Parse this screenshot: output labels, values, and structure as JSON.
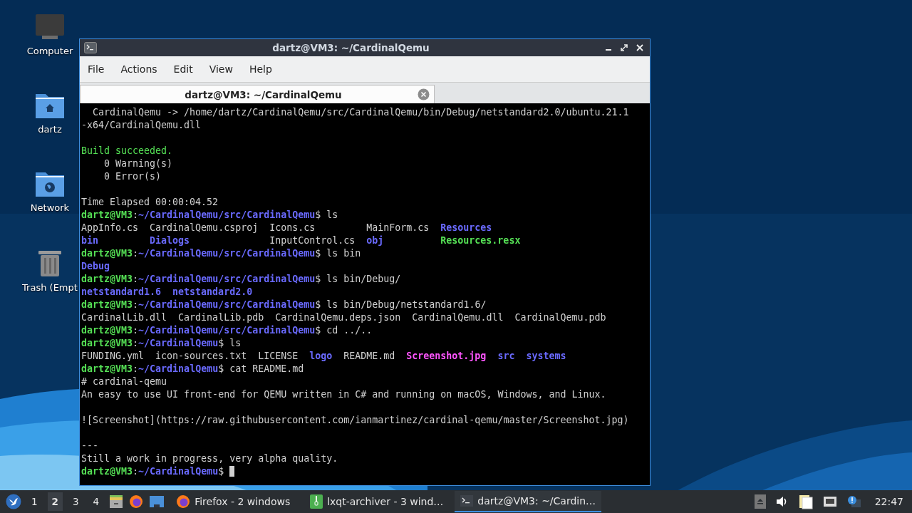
{
  "desktop_icons": [
    {
      "label": "Computer",
      "kind": "computer"
    },
    {
      "label": "dartz",
      "kind": "home"
    },
    {
      "label": "Network",
      "kind": "network"
    },
    {
      "label": "Trash (Empt",
      "kind": "trash"
    }
  ],
  "window": {
    "title": "dartz@VM3: ~/CardinalQemu",
    "menu": [
      "File",
      "Actions",
      "Edit",
      "View",
      "Help"
    ],
    "tabs": [
      {
        "label": "dartz@VM3: ~/CardinalQemu",
        "selected": true
      }
    ],
    "terminal_blocks": [
      {
        "lines": [
          {
            "kind": "text",
            "segments": [
              {
                "kind": "plain",
                "text": "  CardinalQemu -> /home/dartz/CardinalQemu/src/CardinalQemu/bin/Debug/netstandard2.0/ubuntu.21.1"
              }
            ]
          },
          {
            "kind": "text",
            "segments": [
              {
                "kind": "plain",
                "text": "-x64/CardinalQemu.dll"
              }
            ]
          }
        ]
      },
      {
        "lines": [
          {
            "kind": "text",
            "segments": [
              {
                "kind": "success",
                "text": "Build succeeded."
              }
            ]
          },
          {
            "kind": "text",
            "segments": [
              {
                "kind": "plain",
                "text": "    0 Warning(s)"
              }
            ]
          },
          {
            "kind": "text",
            "segments": [
              {
                "kind": "plain",
                "text": "    0 Error(s)"
              }
            ]
          }
        ]
      },
      {
        "lines": [
          {
            "kind": "text",
            "segments": [
              {
                "kind": "plain",
                "text": "Time Elapsed 00:00:04.52"
              }
            ]
          },
          {
            "kind": "text",
            "segments": [
              {
                "kind": "user",
                "text": "dartz@VM3"
              },
              {
                "kind": "plain",
                "text": ":"
              },
              {
                "kind": "path",
                "text": "~/CardinalQemu/src/CardinalQemu"
              },
              {
                "kind": "plain",
                "text": "$ ls"
              }
            ]
          },
          {
            "kind": "grid",
            "segments": [
              {
                "kind": "plain",
                "text": "AppInfo.cs"
              },
              {
                "kind": "plain",
                "text": "CardinalQemu.csproj"
              },
              {
                "kind": "plain",
                "text": "Icons.cs"
              },
              {
                "kind": "plain",
                "text": "MainForm.cs"
              },
              {
                "kind": "dir",
                "text": "Resources"
              }
            ]
          },
          {
            "kind": "grid",
            "segments": [
              {
                "kind": "dir",
                "text": "bin"
              },
              {
                "kind": "dir",
                "text": "Dialogs"
              },
              {
                "kind": "plain",
                "text": "InputControl.cs"
              },
              {
                "kind": "dir",
                "text": "obj"
              },
              {
                "kind": "exec",
                "text": "Resources.resx"
              }
            ]
          },
          {
            "kind": "text",
            "segments": [
              {
                "kind": "user",
                "text": "dartz@VM3"
              },
              {
                "kind": "plain",
                "text": ":"
              },
              {
                "kind": "path",
                "text": "~/CardinalQemu/src/CardinalQemu"
              },
              {
                "kind": "plain",
                "text": "$ ls bin"
              }
            ]
          },
          {
            "kind": "text",
            "segments": [
              {
                "kind": "dir",
                "text": "Debug"
              }
            ]
          },
          {
            "kind": "text",
            "segments": [
              {
                "kind": "user",
                "text": "dartz@VM3"
              },
              {
                "kind": "plain",
                "text": ":"
              },
              {
                "kind": "path",
                "text": "~/CardinalQemu/src/CardinalQemu"
              },
              {
                "kind": "plain",
                "text": "$ ls bin/Debug/"
              }
            ]
          },
          {
            "kind": "list",
            "segments": [
              {
                "kind": "dir",
                "text": "netstandard1.6"
              },
              {
                "kind": "dir",
                "text": "netstandard2.0"
              }
            ]
          },
          {
            "kind": "text",
            "segments": [
              {
                "kind": "user",
                "text": "dartz@VM3"
              },
              {
                "kind": "plain",
                "text": ":"
              },
              {
                "kind": "path",
                "text": "~/CardinalQemu/src/CardinalQemu"
              },
              {
                "kind": "plain",
                "text": "$ ls bin/Debug/netstandard1.6/"
              }
            ]
          },
          {
            "kind": "text",
            "segments": [
              {
                "kind": "plain",
                "text": "CardinalLib.dll  CardinalLib.pdb  CardinalQemu.deps.json  CardinalQemu.dll  CardinalQemu.pdb"
              }
            ]
          },
          {
            "kind": "text",
            "segments": [
              {
                "kind": "user",
                "text": "dartz@VM3"
              },
              {
                "kind": "plain",
                "text": ":"
              },
              {
                "kind": "path",
                "text": "~/CardinalQemu/src/CardinalQemu"
              },
              {
                "kind": "plain",
                "text": "$ cd ../.."
              }
            ]
          },
          {
            "kind": "text",
            "segments": [
              {
                "kind": "user",
                "text": "dartz@VM3"
              },
              {
                "kind": "plain",
                "text": ":"
              },
              {
                "kind": "path",
                "text": "~/CardinalQemu"
              },
              {
                "kind": "plain",
                "text": "$ ls"
              }
            ]
          },
          {
            "kind": "list",
            "segments": [
              {
                "kind": "plain",
                "text": "FUNDING.yml"
              },
              {
                "kind": "plain",
                "text": "icon-sources.txt"
              },
              {
                "kind": "plain",
                "text": "LICENSE"
              },
              {
                "kind": "dir",
                "text": "logo"
              },
              {
                "kind": "plain",
                "text": "README.md"
              },
              {
                "text": "Screenshot.jpg"
              },
              {
                "kind": "dir",
                "text": "src"
              },
              {
                "kind": "dir",
                "text": "systems"
              }
            ]
          },
          {
            "kind": "text",
            "segments": [
              {
                "kind": "user",
                "text": "dartz@VM3"
              },
              {
                "kind": "plain",
                "text": ":"
              },
              {
                "kind": "path",
                "text": "~/CardinalQemu"
              },
              {
                "kind": "plain",
                "text": "$ cat README.md"
              }
            ]
          },
          {
            "kind": "text",
            "segments": [
              {
                "kind": "plain",
                "text": "# cardinal-qemu"
              }
            ]
          },
          {
            "kind": "text",
            "segments": [
              {
                "kind": "plain",
                "text": "An easy to use UI front-end for QEMU written in C# and running on macOS, Windows, and Linux."
              }
            ]
          }
        ]
      },
      {
        "lines": [
          {
            "kind": "text",
            "segments": [
              {
                "kind": "plain",
                "text": "![Screenshot](https://raw.githubusercontent.com/ianmartinez/cardinal-qemu/master/Screenshot.jpg)"
              }
            ]
          }
        ]
      },
      {
        "lines": [
          {
            "kind": "text",
            "segments": [
              {
                "kind": "plain",
                "text": "---"
              }
            ]
          },
          {
            "kind": "text",
            "segments": [
              {
                "kind": "plain",
                "text": "Still a work in progress, very alpha quality."
              }
            ]
          },
          {
            "kind": "text",
            "segments": [
              {
                "kind": "user",
                "text": "dartz@VM3"
              },
              {
                "kind": "plain",
                "text": ":"
              },
              {
                "kind": "path",
                "text": "~/CardinalQemu"
              },
              {
                "kind": "plain",
                "text": "$ "
              }
            ]
          }
        ]
      }
    ]
  },
  "taskbar": {
    "workspaces": [
      {
        "label": "1",
        "selected": false
      },
      {
        "label": "2",
        "selected": true
      },
      {
        "label": "3",
        "selected": false
      },
      {
        "label": "4",
        "selected": false
      }
    ],
    "tasks": [
      {
        "label": "Firefox - 2 windows",
        "kind": "browser",
        "selected": false
      },
      {
        "label": "lxqt-archiver - 3 wind…",
        "kind": "archiver",
        "selected": false
      },
      {
        "label": "dartz@VM3: ~/Cardin…",
        "kind": "terminal",
        "selected": true
      }
    ],
    "clock": "22:47"
  }
}
